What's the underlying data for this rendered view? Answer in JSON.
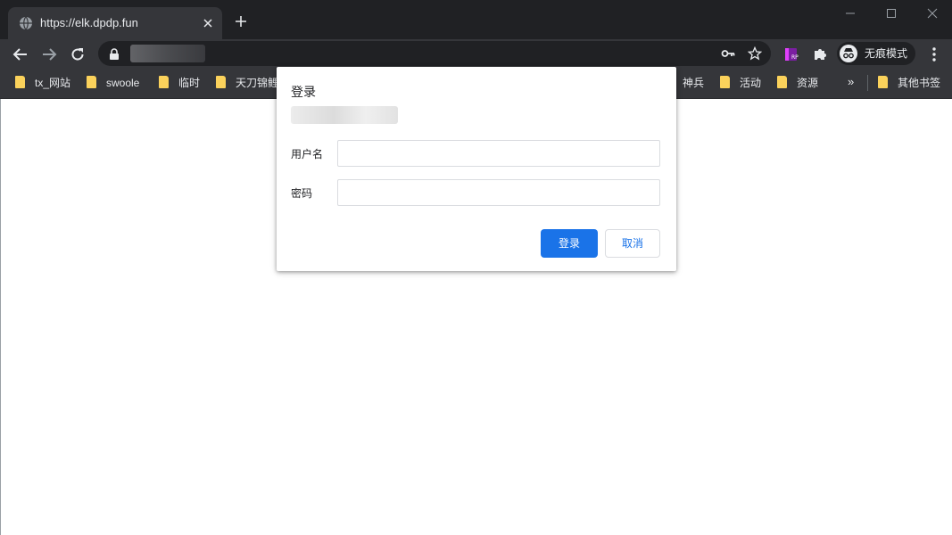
{
  "browser": {
    "tab_title": "https://elk.dpdp.fun",
    "incognito_label": "无痕模式"
  },
  "bookmarks": {
    "items": [
      {
        "label": "tx_网站"
      },
      {
        "label": "swoole"
      },
      {
        "label": "临时"
      },
      {
        "label": "天刀锦鲤"
      },
      {
        "label": "神兵"
      },
      {
        "label": "活动"
      },
      {
        "label": "资源"
      }
    ],
    "overflow_label": "»",
    "other_label": "其他书签"
  },
  "dialog": {
    "title": "登录",
    "username_label": "用户名",
    "password_label": "密码",
    "username_value": "",
    "password_value": "",
    "login_button": "登录",
    "cancel_button": "取消"
  },
  "colors": {
    "browser_frame": "#202124",
    "toolbar": "#35363a",
    "accent": "#1a73e8",
    "folder": "#fbd25b"
  },
  "icons": [
    "globe-icon",
    "close-icon",
    "plus-icon",
    "minimize-icon",
    "maximize-icon",
    "window-close-icon",
    "back-icon",
    "forward-icon",
    "reload-icon",
    "lock-icon",
    "key-icon",
    "star-icon",
    "rp-extension-icon",
    "puzzle-icon",
    "incognito-icon",
    "more-vert-icon",
    "folder-icon"
  ]
}
